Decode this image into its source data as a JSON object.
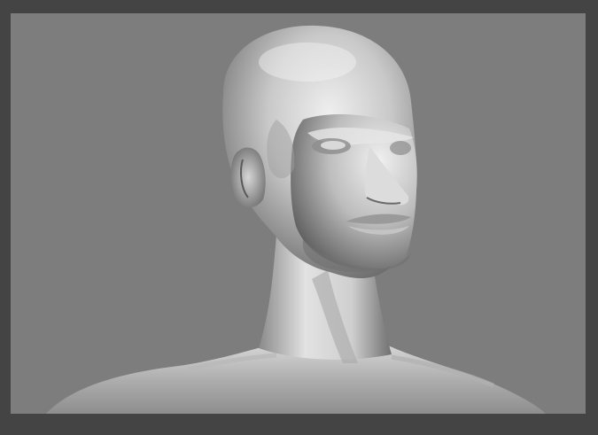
{
  "app": {
    "title": ""
  },
  "viewport": {
    "label": "",
    "background_color": "#7d7d7d",
    "frame_color": "#444444",
    "model": {
      "description_icon": "sculpt-mesh-icon",
      "material_color": "#c8c8c8"
    }
  }
}
